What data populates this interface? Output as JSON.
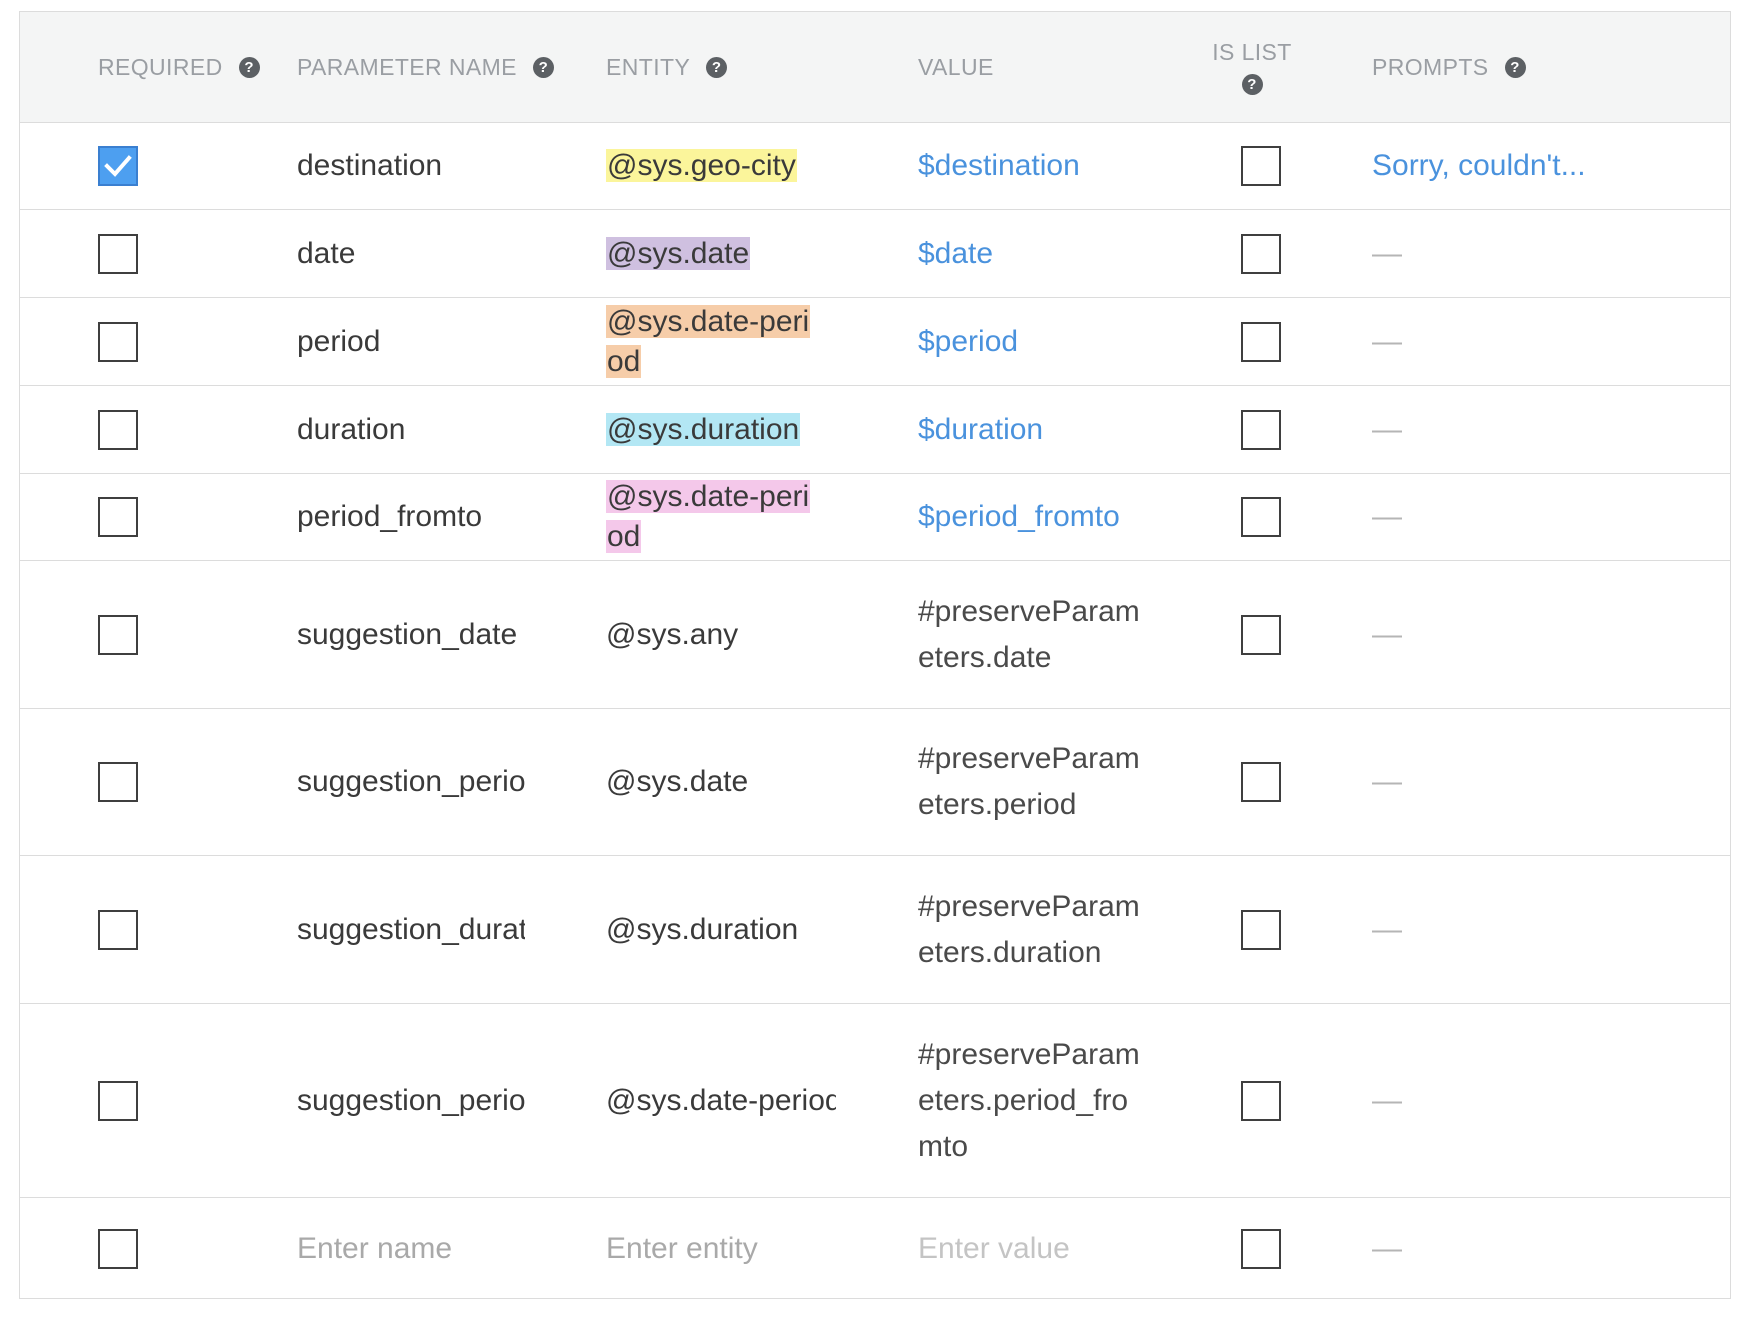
{
  "headers": {
    "required": "REQUIRED",
    "parameter_name": "PARAMETER NAME",
    "entity": "ENTITY",
    "value": "VALUE",
    "is_list": "IS LIST",
    "prompts": "PROMPTS",
    "help_glyph": "?"
  },
  "rows": [
    {
      "required": true,
      "name": "destination",
      "entity": "@sys.geo-city",
      "entity_color": "#fbf59b",
      "value": "$destination",
      "is_list": false,
      "prompt": "Sorry, couldn't..."
    },
    {
      "required": false,
      "name": "date",
      "entity": "@sys.date",
      "entity_color": "#cfc0e0",
      "value": "$date",
      "is_list": false,
      "prompt": "—"
    },
    {
      "required": false,
      "name": "period",
      "entity": "@sys.date-period",
      "entity_color": "#f6cda9",
      "value": "$period",
      "is_list": false,
      "prompt": "—"
    },
    {
      "required": false,
      "name": "duration",
      "entity": "@sys.duration",
      "entity_color": "#b3e7f4",
      "value": "$duration",
      "is_list": false,
      "prompt": "—"
    },
    {
      "required": false,
      "name": "period_fromto",
      "entity": "@sys.date-period",
      "entity_color": "#f4c8ea",
      "value": "$period_fromto",
      "is_list": false,
      "prompt": "—"
    },
    {
      "required": false,
      "name": "suggestion_date",
      "entity": "@sys.any",
      "value": "#preserveParameters.date",
      "is_list": false,
      "prompt": "—"
    },
    {
      "required": false,
      "name": "suggestion_period",
      "entity": "@sys.date",
      "value": "#preserveParameters.period",
      "is_list": false,
      "prompt": "—"
    },
    {
      "required": false,
      "name": "suggestion_duration",
      "entity": "@sys.duration",
      "value": "#preserveParameters.duration",
      "is_list": false,
      "prompt": "—"
    },
    {
      "required": false,
      "name": "suggestion_period_fromto",
      "entity": "@sys.date-period",
      "value": "#preserveParameters.period_fromto",
      "is_list": false,
      "prompt": "—"
    }
  ],
  "new_row": {
    "name_placeholder": "Enter name",
    "entity_placeholder": "Enter entity",
    "value_placeholder": "Enter value",
    "prompt": "—"
  },
  "colors": {
    "accent": "#4a92dd",
    "checkbox_checked": "#4d9ff0",
    "header_bg": "#f4f5f5"
  }
}
